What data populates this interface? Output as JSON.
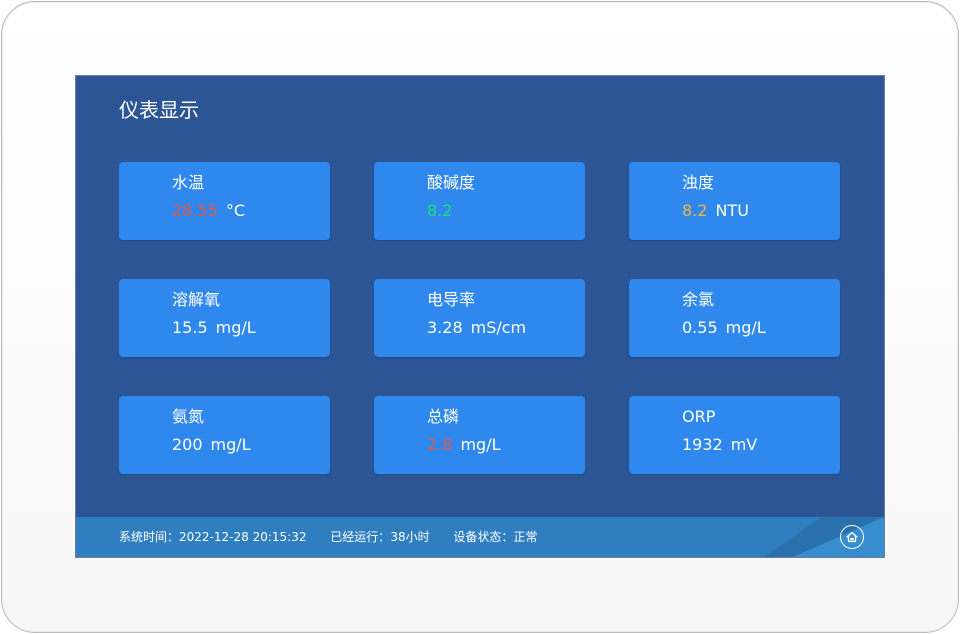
{
  "panel": {
    "title": "仪表显示"
  },
  "cards": [
    {
      "label": "水温",
      "value": "28.55",
      "unit": "°C",
      "value_color": "#e2574c"
    },
    {
      "label": "酸碱度",
      "value": "8.2",
      "unit": "",
      "value_color": "#1fe07a"
    },
    {
      "label": "浊度",
      "value": "8.2",
      "unit": "NTU",
      "value_color": "#f3b63a"
    },
    {
      "label": "溶解氧",
      "value": "15.5",
      "unit": "mg/L",
      "value_color": "#ffffff"
    },
    {
      "label": "电导率",
      "value": "3.28",
      "unit": "mS/cm",
      "value_color": "#ffffff"
    },
    {
      "label": "余氯",
      "value": "0.55",
      "unit": "mg/L",
      "value_color": "#ffffff"
    },
    {
      "label": "氨氮",
      "value": "200",
      "unit": "mg/L",
      "value_color": "#ffffff"
    },
    {
      "label": "总磷",
      "value": "2.8",
      "unit": "mg/L",
      "value_color": "#e2574c"
    },
    {
      "label": "ORP",
      "value": "1932",
      "unit": "mV",
      "value_color": "#ffffff"
    }
  ],
  "status": {
    "system_time_label": "系统时间：",
    "system_time": "2022-12-28 20:15:32",
    "runtime_label": "已经运行：",
    "runtime": "38小时",
    "device_status_label": "设备状态：",
    "device_status": "正常"
  },
  "icons": {
    "home": "home-icon"
  }
}
